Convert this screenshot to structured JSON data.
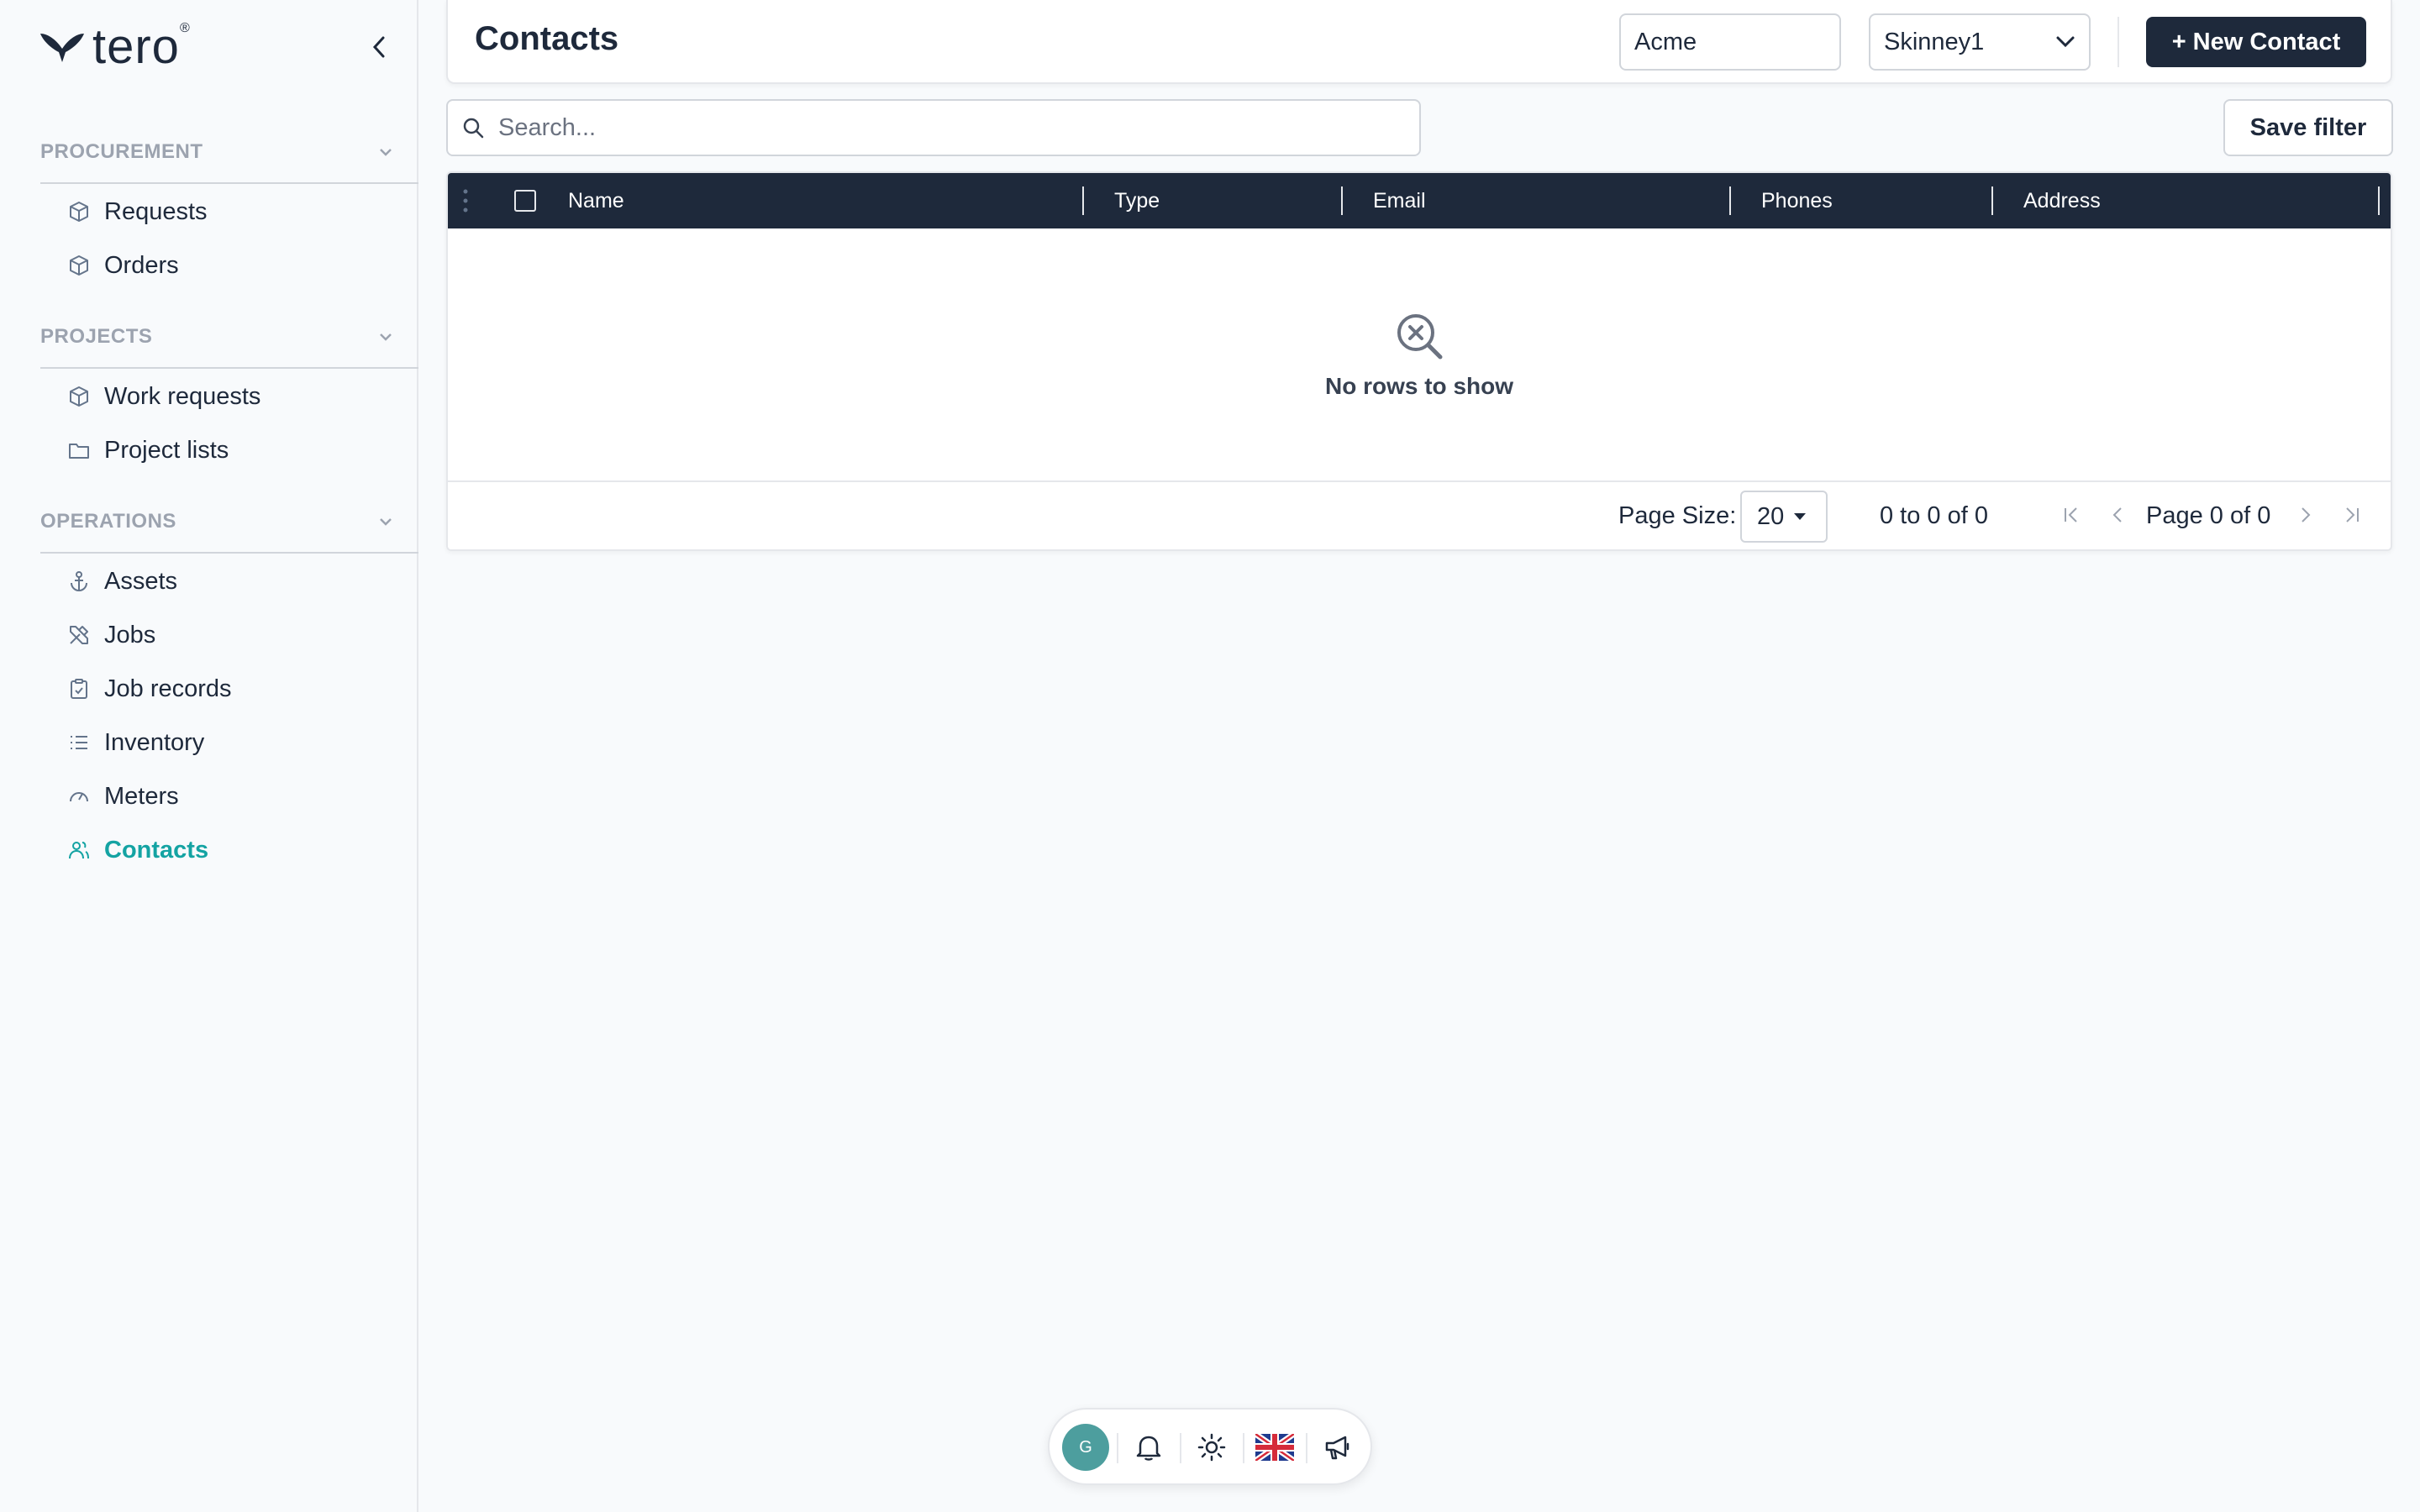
{
  "brand": {
    "name": "tero",
    "reg_mark": "®"
  },
  "sidebar": {
    "sections": [
      {
        "title": "PROCUREMENT",
        "items": [
          {
            "label": "Requests",
            "icon": "box-icon"
          },
          {
            "label": "Orders",
            "icon": "box-icon"
          }
        ]
      },
      {
        "title": "PROJECTS",
        "items": [
          {
            "label": "Work requests",
            "icon": "box-icon"
          },
          {
            "label": "Project lists",
            "icon": "folder-icon"
          }
        ]
      },
      {
        "title": "OPERATIONS",
        "items": [
          {
            "label": "Assets",
            "icon": "anchor-icon"
          },
          {
            "label": "Jobs",
            "icon": "tools-icon"
          },
          {
            "label": "Job records",
            "icon": "clipboard-icon"
          },
          {
            "label": "Inventory",
            "icon": "list-icon"
          },
          {
            "label": "Meters",
            "icon": "gauge-icon"
          },
          {
            "label": "Contacts",
            "icon": "users-icon",
            "active": true
          }
        ]
      }
    ]
  },
  "header": {
    "title": "Contacts",
    "company_value": "Acme",
    "site_value": "Skinney1",
    "new_button_label": "+ New Contact"
  },
  "search": {
    "placeholder": "Search..."
  },
  "save_filter_label": "Save filter",
  "grid": {
    "columns": [
      "Name",
      "Type",
      "Email",
      "Phones",
      "Address"
    ],
    "empty_message": "No rows to show",
    "page_size_label": "Page Size:",
    "page_size_value": "20",
    "row_summary": "0 to 0 of 0",
    "page_description": "Page 0 of 0"
  },
  "toolbar": {
    "avatar_initial": "G"
  },
  "colors": {
    "accent": "#14a3a3",
    "dark": "#1e293b",
    "avatar": "#4d9e9e"
  }
}
